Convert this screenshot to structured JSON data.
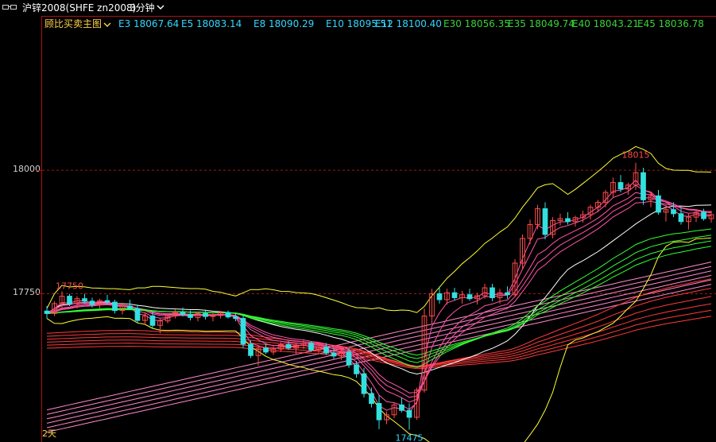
{
  "titlebar": {
    "symbol": "沪锌2008(SHFE zn2008)",
    "period": "3分钟",
    "chevron_icon": "chevron-down-icon"
  },
  "indicator": {
    "name": "顾比买卖主图",
    "chevron_icon": "chevron-down-icon"
  },
  "legend": [
    {
      "label": "E3 18067.64",
      "color": "#33d6ff"
    },
    {
      "label": "E5 18083.14",
      "color": "#33d6ff"
    },
    {
      "label": "E8 18090.29",
      "color": "#33d6ff"
    },
    {
      "label": "E10 18095.51",
      "color": "#33d6ff"
    },
    {
      "label": "E12 18100.40",
      "color": "#33d6ff"
    },
    {
      "label": "E30 18056.35",
      "color": "#3ad13a"
    },
    {
      "label": "E35 18049.74",
      "color": "#3ad13a"
    },
    {
      "label": "E40 18043.21",
      "color": "#3ad13a"
    },
    {
      "label": "E45 18036.78",
      "color": "#3ad13a"
    }
  ],
  "corner_label": "2天",
  "colors": {
    "up_candle": "#ff4a4a",
    "down_candle": "#33e0e0",
    "grid_dashed": "#a01818",
    "bollinger": "#ffff33",
    "short_ema_band": "#ff55aa",
    "long_ema_band": "#ff3a3a",
    "slow_band": "#ff88cc",
    "green_ema": "#33ff33"
  },
  "chart_data": {
    "type": "candlestick",
    "title": "沪锌2008(SHFE zn2008) 3分钟",
    "ylim": [
      17450,
      18280
    ],
    "y_ticks": [
      17750,
      18000
    ],
    "grid": "dashed horizontal at tick levels",
    "annotations": [
      {
        "label": "17750",
        "value": 17750,
        "kind": "local-high"
      },
      {
        "label": "18015",
        "value": 18015,
        "kind": "high"
      },
      {
        "label": "17475",
        "value": 17475,
        "kind": "low"
      }
    ],
    "candles": [
      [
        17715,
        17725,
        17700,
        17710
      ],
      [
        17710,
        17735,
        17705,
        17730
      ],
      [
        17730,
        17755,
        17720,
        17745
      ],
      [
        17745,
        17750,
        17725,
        17730
      ],
      [
        17730,
        17745,
        17720,
        17740
      ],
      [
        17740,
        17750,
        17730,
        17735
      ],
      [
        17735,
        17742,
        17722,
        17728
      ],
      [
        17728,
        17740,
        17720,
        17736
      ],
      [
        17736,
        17748,
        17728,
        17733
      ],
      [
        17733,
        17738,
        17710,
        17716
      ],
      [
        17716,
        17732,
        17708,
        17725
      ],
      [
        17725,
        17738,
        17718,
        17720
      ],
      [
        17720,
        17728,
        17690,
        17696
      ],
      [
        17696,
        17712,
        17688,
        17705
      ],
      [
        17705,
        17714,
        17680,
        17686
      ],
      [
        17686,
        17700,
        17670,
        17695
      ],
      [
        17695,
        17710,
        17690,
        17705
      ],
      [
        17705,
        17718,
        17700,
        17712
      ],
      [
        17712,
        17722,
        17704,
        17708
      ],
      [
        17708,
        17716,
        17696,
        17702
      ],
      [
        17702,
        17714,
        17694,
        17710
      ],
      [
        17710,
        17718,
        17698,
        17704
      ],
      [
        17704,
        17712,
        17694,
        17706
      ],
      [
        17706,
        17715,
        17700,
        17712
      ],
      [
        17712,
        17716,
        17700,
        17703
      ],
      [
        17703,
        17710,
        17694,
        17700
      ],
      [
        17700,
        17706,
        17640,
        17648
      ],
      [
        17648,
        17655,
        17620,
        17625
      ],
      [
        17625,
        17646,
        17604,
        17640
      ],
      [
        17640,
        17650,
        17628,
        17632
      ],
      [
        17632,
        17644,
        17626,
        17638
      ],
      [
        17638,
        17652,
        17632,
        17647
      ],
      [
        17647,
        17654,
        17636,
        17640
      ],
      [
        17640,
        17650,
        17628,
        17646
      ],
      [
        17646,
        17656,
        17638,
        17650
      ],
      [
        17650,
        17654,
        17632,
        17636
      ],
      [
        17636,
        17648,
        17628,
        17642
      ],
      [
        17642,
        17650,
        17626,
        17630
      ],
      [
        17630,
        17640,
        17618,
        17624
      ],
      [
        17624,
        17638,
        17616,
        17632
      ],
      [
        17632,
        17640,
        17600,
        17606
      ],
      [
        17606,
        17614,
        17580,
        17588
      ],
      [
        17588,
        17600,
        17540,
        17548
      ],
      [
        17548,
        17560,
        17520,
        17528
      ],
      [
        17528,
        17544,
        17476,
        17495
      ],
      [
        17495,
        17512,
        17486,
        17505
      ],
      [
        17505,
        17530,
        17498,
        17525
      ],
      [
        17525,
        17540,
        17510,
        17514
      ],
      [
        17514,
        17528,
        17475,
        17500
      ],
      [
        17500,
        17560,
        17495,
        17555
      ],
      [
        17555,
        17720,
        17550,
        17705
      ],
      [
        17705,
        17760,
        17690,
        17750
      ],
      [
        17750,
        17765,
        17730,
        17738
      ],
      [
        17738,
        17760,
        17728,
        17752
      ],
      [
        17752,
        17762,
        17736,
        17742
      ],
      [
        17742,
        17756,
        17730,
        17748
      ],
      [
        17748,
        17760,
        17736,
        17740
      ],
      [
        17740,
        17752,
        17728,
        17746
      ],
      [
        17746,
        17770,
        17740,
        17762
      ],
      [
        17762,
        17770,
        17735,
        17742
      ],
      [
        17742,
        17760,
        17730,
        17752
      ],
      [
        17752,
        17765,
        17740,
        17748
      ],
      [
        17748,
        17820,
        17745,
        17812
      ],
      [
        17812,
        17870,
        17800,
        17862
      ],
      [
        17862,
        17900,
        17850,
        17890
      ],
      [
        17890,
        17930,
        17880,
        17922
      ],
      [
        17922,
        17935,
        17860,
        17870
      ],
      [
        17870,
        17905,
        17862,
        17898
      ],
      [
        17898,
        17912,
        17888,
        17902
      ],
      [
        17902,
        17915,
        17890,
        17896
      ],
      [
        17896,
        17908,
        17886,
        17904
      ],
      [
        17904,
        17918,
        17894,
        17910
      ],
      [
        17910,
        17930,
        17900,
        17925
      ],
      [
        17925,
        17940,
        17915,
        17935
      ],
      [
        17935,
        17960,
        17925,
        17955
      ],
      [
        17955,
        17985,
        17945,
        17975
      ],
      [
        17975,
        17990,
        17955,
        17962
      ],
      [
        17962,
        17975,
        17950,
        17970
      ],
      [
        17970,
        18015,
        17960,
        17995
      ],
      [
        17995,
        18005,
        17930,
        17940
      ],
      [
        17940,
        17955,
        17925,
        17948
      ],
      [
        17948,
        17960,
        17910,
        17915
      ],
      [
        17915,
        17930,
        17896,
        17920
      ],
      [
        17920,
        17935,
        17905,
        17912
      ],
      [
        17912,
        17925,
        17890,
        17896
      ],
      [
        17896,
        17912,
        17880,
        17905
      ],
      [
        17905,
        17920,
        17895,
        17915
      ],
      [
        17915,
        17922,
        17898,
        17902
      ],
      [
        17902,
        17918,
        17894,
        17910
      ]
    ]
  }
}
